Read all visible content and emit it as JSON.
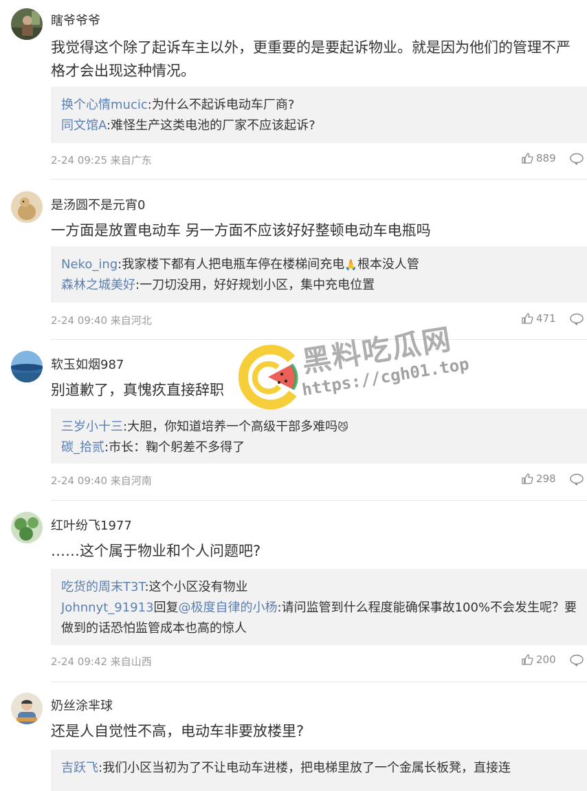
{
  "comments": [
    {
      "user": "瞎爷爷爷",
      "text": "我觉得这个除了起诉车主以外，更重要的是要起诉物业。就是因为他们的管理不严格才会出现这种情况。",
      "replies": [
        {
          "user": "换个心情mucic",
          "text": ":为什么不起诉电动车厂商?"
        },
        {
          "user": "同文馆A",
          "text": ":难怪生产这类电池的厂家不应该起诉?"
        }
      ],
      "meta": "2-24 09:25 来自广东",
      "likes": "889"
    },
    {
      "user": "是汤圆不是元宵0",
      "text": "一方面是放置电动车 另一方面不应该好好整顿电动车电瓶吗",
      "replies": [
        {
          "user": "Neko_ing",
          "text": ":我家楼下都有人把电瓶车停在楼梯间充电",
          "emoji": "🙏",
          "text2": "根本没人管"
        },
        {
          "user": "森林之城美好",
          "text": ":一刀切没用，好好规划小区，集中充电位置"
        }
      ],
      "meta": "2-24 09:40 来自河北",
      "likes": "471"
    },
    {
      "user": "软玉如烟987",
      "text": "别道歉了，真愧疚直接辞职",
      "replies": [
        {
          "user": "三岁小十三",
          "text": ":大胆，你知道培养一个高级干部多难吗",
          "emoji": "😼"
        },
        {
          "user": "碳_拾贰",
          "text": ":市长：鞠个躬差不多得了"
        }
      ],
      "meta": "2-24 09:40 来自河南",
      "likes": "298"
    },
    {
      "user": "红叶纷飞1977",
      "text": "……这个属于物业和个人问题吧?",
      "replies": [
        {
          "user": "吃货的周末T3T",
          "text": ":这个小区没有物业"
        },
        {
          "user": "Johnnyt_91913",
          "reply_word": "回复",
          "mention": "@极度自律的小杨",
          "text": ":请问监管到什么程度能确保事故100%不会发生呢？要做到的话恐怕监管成本也高的惊人"
        }
      ],
      "meta": "2-24 09:42 来自山西",
      "likes": "200"
    },
    {
      "user": "奶丝涂芈球",
      "text": "还是人自觉性不高，电动车非要放楼里?",
      "replies": [
        {
          "user": "吉跃飞",
          "text": ":我们小区当初为了不让电动车进楼，把电梯里放了一个金属长板凳，直接连"
        }
      ]
    }
  ],
  "watermark": {
    "title": "黑料吃瓜网",
    "url": "https://cgh01.top"
  },
  "colors": {
    "link_blue": "#5a7fb3",
    "reply_bg": "#f2f2f2",
    "meta_gray": "#9a9a9a",
    "logo_yellow": "#f5c518",
    "logo_red": "#e8443a",
    "logo_green": "#3da35a"
  },
  "icons": {
    "like": "thumbs-up-icon",
    "comment": "comment-bubble-icon"
  }
}
